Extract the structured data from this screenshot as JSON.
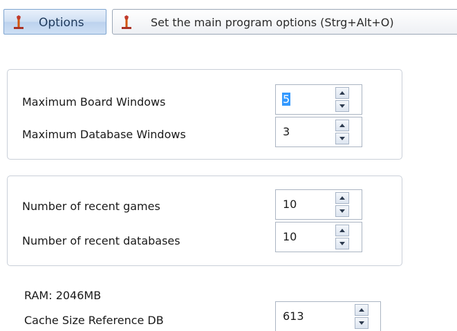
{
  "toolbar": {
    "options_label": "Options",
    "options_icon": "wrench-icon",
    "tooltip_text": "Set the main program options (Strg+Alt+O)",
    "tooltip_icon": "wrench-icon"
  },
  "windows_group": {
    "rows": [
      {
        "label": "Maximum Board Windows",
        "value": "5",
        "selected": true
      },
      {
        "label": "Maximum Database Windows",
        "value": "3",
        "selected": false
      }
    ]
  },
  "recent_group": {
    "rows": [
      {
        "label": "Number of recent games",
        "value": "10"
      },
      {
        "label": "Number of recent databases",
        "value": "10"
      }
    ]
  },
  "memory": {
    "ram_label": "RAM: 2046MB",
    "cache_label": "Cache Size Reference DB",
    "cache_value": "613"
  },
  "colors": {
    "accent": "#3399ff",
    "button_border": "#7ea4cf",
    "panel_border": "#c9cfd8"
  }
}
